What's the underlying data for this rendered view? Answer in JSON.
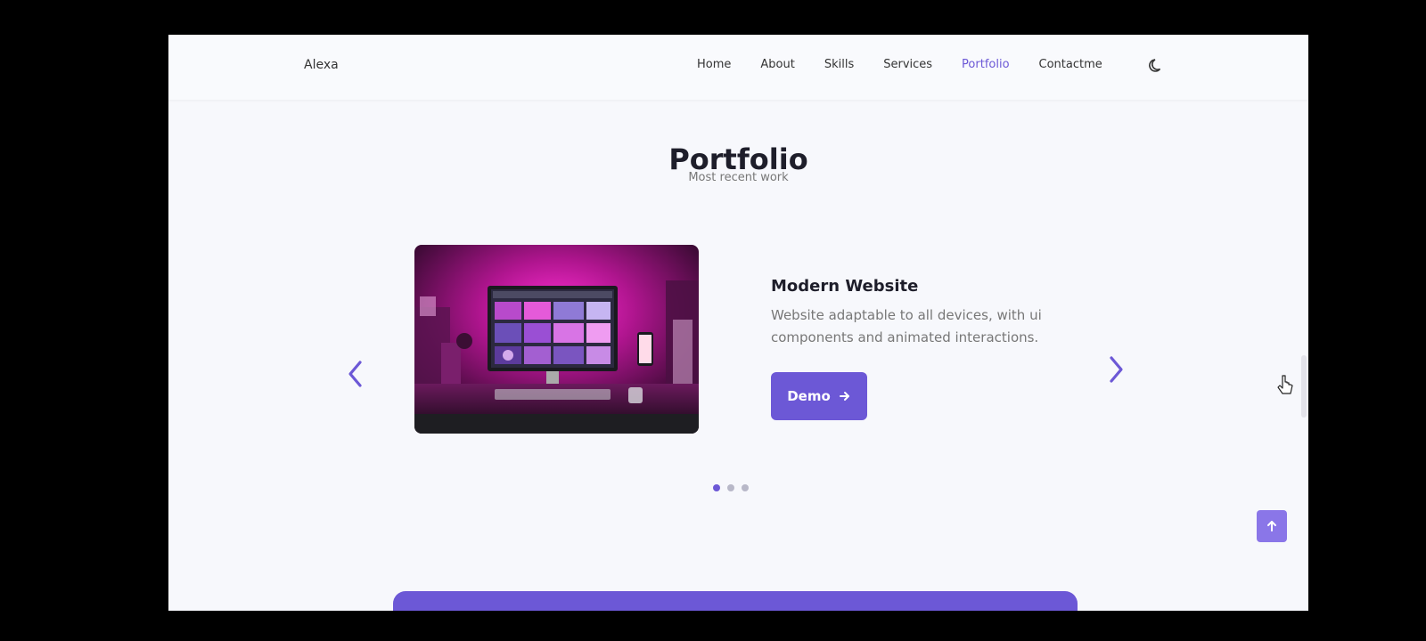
{
  "navbar": {
    "logo": "Alexa",
    "links": [
      {
        "label": "Home",
        "active": false
      },
      {
        "label": "About",
        "active": false
      },
      {
        "label": "Skills",
        "active": false
      },
      {
        "label": "Services",
        "active": false
      },
      {
        "label": "Portfolio",
        "active": true
      },
      {
        "label": "Contactme",
        "active": false
      }
    ],
    "theme_icon": "moon-icon"
  },
  "section": {
    "title": "Portfolio",
    "subtitle": "Most recent work"
  },
  "slide": {
    "title": "Modern Website",
    "description": "Website adaptable to all devices, with ui components and animated interactions.",
    "button_label": "Demo",
    "button_icon": "arrow-right-icon",
    "image": "desk-computer-setup-magenta"
  },
  "carousel": {
    "prev_icon": "chevron-left-icon",
    "next_icon": "chevron-right-icon",
    "pagination_count": 3,
    "active_index": 0
  },
  "scroll_up_icon": "arrow-up-icon",
  "colors": {
    "accent": "#6c58d6",
    "background": "#f7f8fc",
    "title": "#1e1e2a",
    "text": "#777777"
  }
}
